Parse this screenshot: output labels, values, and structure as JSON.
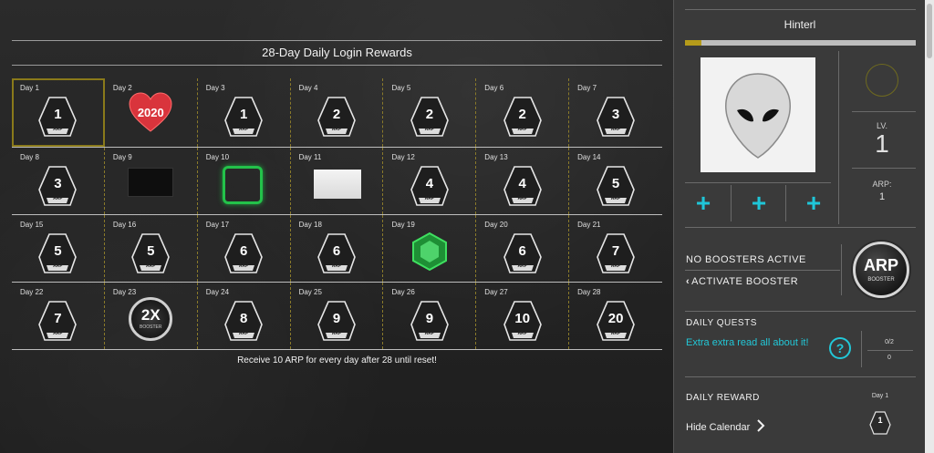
{
  "calendar": {
    "title": "28-Day Daily Login Rewards",
    "footer_note": "Receive 10 ARP for every day after 28 until reset!",
    "current_day": 1,
    "tile_tag": "ARP",
    "days": [
      {
        "label": "Day 1",
        "kind": "arp",
        "value": "1"
      },
      {
        "label": "Day 2",
        "kind": "heart",
        "value": "2020"
      },
      {
        "label": "Day 3",
        "kind": "arp",
        "value": "1"
      },
      {
        "label": "Day 4",
        "kind": "arp",
        "value": "2"
      },
      {
        "label": "Day 5",
        "kind": "arp",
        "value": "2"
      },
      {
        "label": "Day 6",
        "kind": "arp",
        "value": "2"
      },
      {
        "label": "Day 7",
        "kind": "arp",
        "value": "3"
      },
      {
        "label": "Day 8",
        "kind": "arp",
        "value": "3"
      },
      {
        "label": "Day 9",
        "kind": "image-dark",
        "value": ""
      },
      {
        "label": "Day 10",
        "kind": "image-green-frame",
        "value": ""
      },
      {
        "label": "Day 11",
        "kind": "image-light",
        "value": ""
      },
      {
        "label": "Day 12",
        "kind": "arp",
        "value": "4"
      },
      {
        "label": "Day 13",
        "kind": "arp",
        "value": "4"
      },
      {
        "label": "Day 14",
        "kind": "arp",
        "value": "5"
      },
      {
        "label": "Day 15",
        "kind": "arp",
        "value": "5"
      },
      {
        "label": "Day 16",
        "kind": "arp",
        "value": "5"
      },
      {
        "label": "Day 17",
        "kind": "arp",
        "value": "6"
      },
      {
        "label": "Day 18",
        "kind": "arp",
        "value": "6"
      },
      {
        "label": "Day 19",
        "kind": "gem",
        "value": ""
      },
      {
        "label": "Day 20",
        "kind": "arp",
        "value": "6"
      },
      {
        "label": "Day 21",
        "kind": "arp",
        "value": "7"
      },
      {
        "label": "Day 22",
        "kind": "arp",
        "value": "7"
      },
      {
        "label": "Day 23",
        "kind": "booster",
        "value": "2X",
        "sub": "BOOSTER"
      },
      {
        "label": "Day 24",
        "kind": "arp",
        "value": "8"
      },
      {
        "label": "Day 25",
        "kind": "arp",
        "value": "9"
      },
      {
        "label": "Day 26",
        "kind": "arp",
        "value": "9"
      },
      {
        "label": "Day 27",
        "kind": "arp",
        "value": "10"
      },
      {
        "label": "Day 28",
        "kind": "arp",
        "value": "20"
      }
    ]
  },
  "profile": {
    "username": "Hinterl",
    "xp_progress": 0.07,
    "level_label": "LV.",
    "level_value": "1",
    "arp_label": "ARP:",
    "arp_value": "1",
    "add_slots": [
      "+",
      "+",
      "+"
    ]
  },
  "booster": {
    "status": "NO BOOSTERS ACTIVE",
    "activate_label": "ACTIVATE BOOSTER",
    "button_big": "ARP",
    "button_small": "BOOSTER"
  },
  "daily_quests": {
    "title": "DAILY QUESTS",
    "quest_text": "Extra extra read all about it!",
    "help_glyph": "?",
    "progress": "0/2",
    "reward": "0"
  },
  "daily_reward": {
    "title": "DAILY REWARD",
    "hide_label": "Hide Calendar",
    "day_label": "Day 1",
    "tile_value": "1"
  },
  "colors": {
    "accent_cyan": "#22c8d8",
    "current_day_outline": "#8a7a1a",
    "xp_fill": "#b59b1a"
  }
}
